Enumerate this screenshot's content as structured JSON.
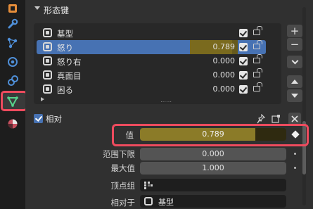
{
  "app": {
    "accent": "#4772b3",
    "highlight": "#ee4b5e",
    "value_color": "#8b7b28"
  },
  "sidebar": {
    "tabs": [
      {
        "icon": "object-icon"
      },
      {
        "icon": "wrench-icon"
      },
      {
        "icon": "particles-icon"
      },
      {
        "icon": "physics-icon"
      },
      {
        "icon": "constraint-icon"
      },
      {
        "icon": "data-triangle-icon",
        "selected": true
      },
      {
        "icon": "material-icon"
      }
    ]
  },
  "panel": {
    "section_title": "形态键",
    "shape_keys": [
      {
        "name": "基型",
        "value": ""
      },
      {
        "name": "怒り",
        "value": "0.789",
        "active": true
      },
      {
        "name": "怒り右",
        "value": "0.000"
      },
      {
        "name": "真面目",
        "value": "0.000"
      },
      {
        "name": "困る",
        "value": "0.000"
      }
    ],
    "side_buttons": {
      "add": "+",
      "remove": "−"
    },
    "relative_label": "相对",
    "value": {
      "label": "值",
      "value": "0.789",
      "fraction": 0.789
    },
    "range_min": {
      "label": "范围下限",
      "value": "0.000"
    },
    "max_value": {
      "label": "最大值",
      "value": "1.000"
    },
    "vertex_group": {
      "label": "顶点组",
      "value": ""
    },
    "relative_to": {
      "label": "相对于",
      "value": "基型"
    }
  }
}
